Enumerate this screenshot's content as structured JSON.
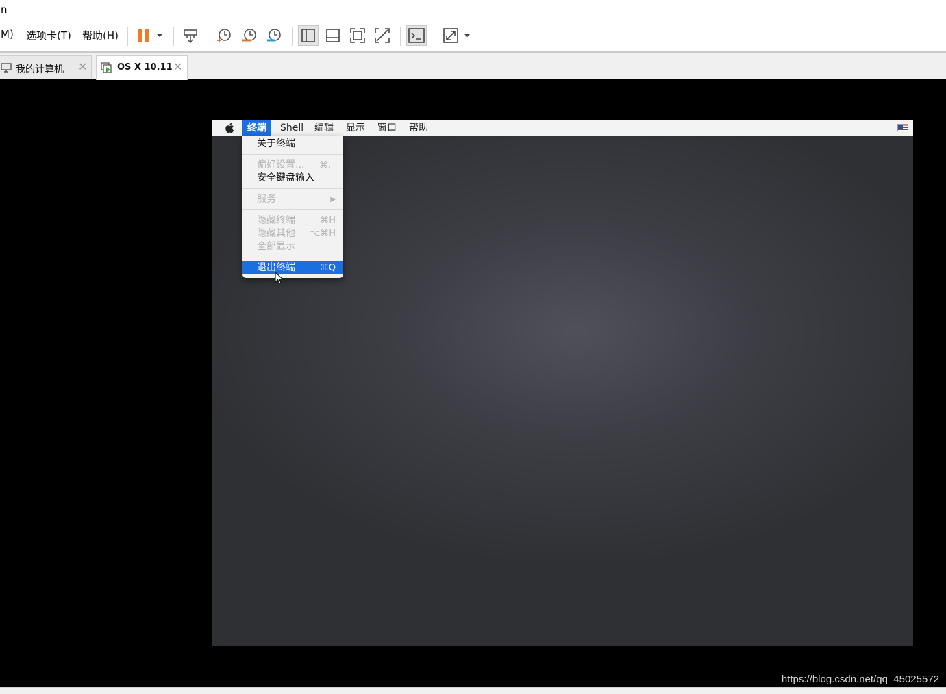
{
  "window": {
    "title_fragment": "n"
  },
  "menubar": {
    "items": [
      "M)",
      "选项卡(T)",
      "帮助(H)"
    ]
  },
  "toolbar": {
    "buttons": [
      "pause-icon",
      "dropdown-arrow-icon",
      "send-ctrl-alt-del-icon",
      "snapshot-icon",
      "revert-snapshot-icon",
      "snapshot-manager-icon",
      "library-view-icon",
      "thumbnail-bar-icon",
      "fullscreen-icon",
      "unity-icon",
      "console-view-icon",
      "stretch-guest-icon",
      "dropdown-arrow-icon"
    ],
    "accent_pause": "#f07b26"
  },
  "tabs": [
    {
      "label": "我的计算机",
      "close": "✕"
    },
    {
      "label": "OS X 10.11",
      "close": "✕"
    }
  ],
  "mac": {
    "menu": [
      "终端",
      "Shell",
      "编辑",
      "显示",
      "窗口",
      "帮助"
    ],
    "dropdown": {
      "about": "关于终端",
      "prefs": {
        "label": "偏好设置...",
        "shortcut": "⌘,"
      },
      "secure": "安全键盘输入",
      "services": {
        "label": "服务",
        "arrow": "▶"
      },
      "hide": {
        "label": "隐藏终端",
        "shortcut": "⌘H"
      },
      "hide_others": {
        "label": "隐藏其他",
        "shortcut": "⌥⌘H"
      },
      "show_all": "全部显示",
      "quit": {
        "label": "退出终端",
        "shortcut": "⌘Q"
      }
    },
    "highlight_color": "#1b6fe0"
  },
  "watermark": "https://blog.csdn.net/qq_45025572"
}
